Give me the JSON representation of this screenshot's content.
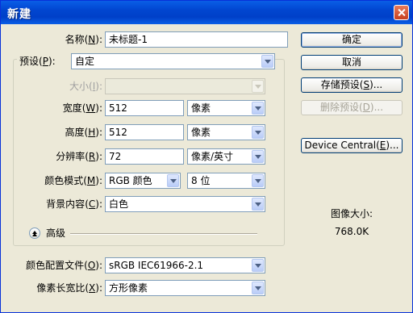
{
  "window": {
    "title": "新建"
  },
  "name": {
    "label": "名称",
    "key": "N",
    "value": "未标题-1"
  },
  "preset": {
    "label": "预设",
    "key": "P",
    "value": "自定"
  },
  "size": {
    "label": "大小",
    "key": "I",
    "value": ""
  },
  "width": {
    "label": "宽度",
    "key": "W",
    "value": "512",
    "unit": "像素"
  },
  "height": {
    "label": "高度",
    "key": "H",
    "value": "512",
    "unit": "像素"
  },
  "resolution": {
    "label": "分辨率",
    "key": "R",
    "value": "72",
    "unit": "像素/英寸"
  },
  "color_mode": {
    "label": "颜色模式",
    "key": "M",
    "value": "RGB 颜色",
    "depth": "8 位"
  },
  "background": {
    "label": "背景内容",
    "key": "C",
    "value": "白色"
  },
  "advanced": {
    "label": "高级"
  },
  "color_profile": {
    "label": "颜色配置文件",
    "key": "O",
    "value": "sRGB IEC61966-2.1"
  },
  "pixel_aspect": {
    "label": "像素长宽比",
    "key": "X",
    "value": "方形像素"
  },
  "buttons": {
    "ok": "确定",
    "cancel": "取消",
    "save_preset": {
      "text": "存储预设",
      "key": "S",
      "suffix": "..."
    },
    "delete_preset": {
      "text": "删除预设",
      "key": "D",
      "suffix": "..."
    },
    "device_central": {
      "text": "Device Central",
      "key": "E",
      "suffix": "..."
    }
  },
  "image_size": {
    "label": "图像大小:",
    "value": "768.0K"
  }
}
